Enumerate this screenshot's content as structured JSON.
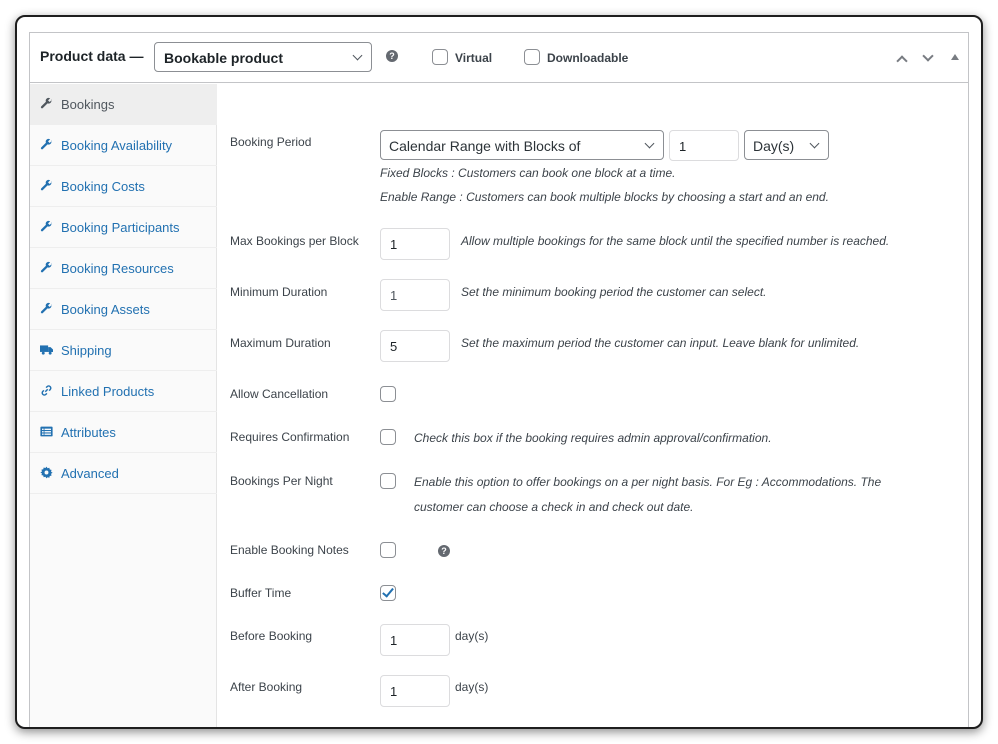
{
  "header": {
    "title": "Product data —",
    "product_type": "Bookable product",
    "help_icon": "?",
    "virtual_label": "Virtual",
    "downloadable_label": "Downloadable",
    "virtual_checked": false,
    "downloadable_checked": false
  },
  "sidebar": {
    "items": [
      {
        "label": "Bookings",
        "icon": "wrench-icon",
        "active": true
      },
      {
        "label": "Booking Availability",
        "icon": "wrench-icon",
        "active": false
      },
      {
        "label": "Booking Costs",
        "icon": "wrench-icon",
        "active": false
      },
      {
        "label": "Booking Participants",
        "icon": "wrench-icon",
        "active": false
      },
      {
        "label": "Booking Resources",
        "icon": "wrench-icon",
        "active": false
      },
      {
        "label": "Booking Assets",
        "icon": "wrench-icon",
        "active": false
      },
      {
        "label": "Shipping",
        "icon": "truck-icon",
        "active": false
      },
      {
        "label": "Linked Products",
        "icon": "link-icon",
        "active": false
      },
      {
        "label": "Attributes",
        "icon": "list-icon",
        "active": false
      },
      {
        "label": "Advanced",
        "icon": "gear-icon",
        "active": false
      }
    ]
  },
  "form": {
    "booking_period": {
      "label": "Booking Period",
      "type_value": "Calendar Range with Blocks of",
      "block_value": "1",
      "unit_value": "Day(s)",
      "desc_fixed": "Fixed Blocks : Customers can book one block at a time.",
      "desc_range": "Enable Range : Customers can book multiple blocks by choosing a start and an end."
    },
    "max_bookings": {
      "label": "Max Bookings per Block",
      "value": "1",
      "desc": "Allow multiple bookings for the same block until the specified number is reached."
    },
    "min_duration": {
      "label": "Minimum Duration",
      "value": "1",
      "desc": "Set the minimum booking period the customer can select."
    },
    "max_duration": {
      "label": "Maximum Duration",
      "value": "5",
      "desc": "Set the maximum period the customer can input. Leave blank for unlimited."
    },
    "allow_cancellation": {
      "label": "Allow Cancellation",
      "checked": false
    },
    "requires_confirmation": {
      "label": "Requires Confirmation",
      "checked": false,
      "desc": "Check this box if the booking requires admin approval/confirmation."
    },
    "per_night": {
      "label": "Bookings Per Night",
      "checked": false,
      "desc_line1": "Enable this option to offer bookings on a per night basis. For Eg : Accommodations. The",
      "desc_line2": "customer can choose a check in and check out date."
    },
    "booking_notes": {
      "label": "Enable Booking Notes",
      "checked": false,
      "help_icon": "?"
    },
    "buffer_time": {
      "label": "Buffer Time",
      "checked": true
    },
    "before_booking": {
      "label": "Before Booking",
      "value": "1",
      "unit": "day(s)"
    },
    "after_booking": {
      "label": "After Booking",
      "value": "1",
      "unit": "day(s)"
    }
  },
  "colors": {
    "link": "#2271b1",
    "border": "#c3c4c7",
    "sidebar_bg": "#fafafa",
    "active_tab_bg": "#eeeeee"
  }
}
